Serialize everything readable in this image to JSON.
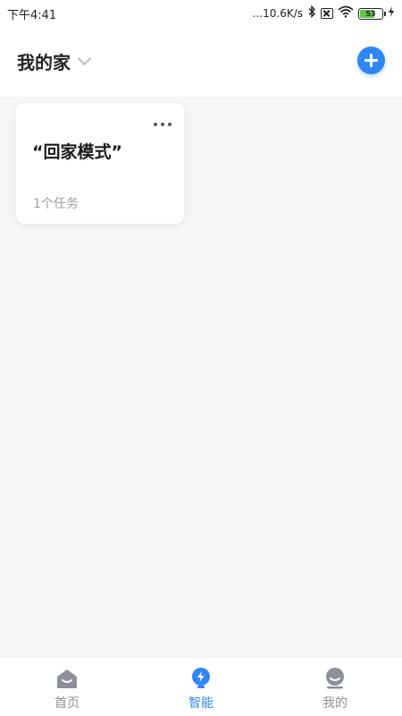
{
  "status_bar": {
    "time": "下午4:41",
    "network_speed": "...10.6K/s",
    "battery_level": "53",
    "icons": [
      "bluetooth-icon",
      "sim-off-icon",
      "wifi-icon",
      "battery-icon",
      "charging-icon"
    ]
  },
  "header": {
    "home_title": "我的家",
    "add_icon": "plus-icon",
    "accent_color": "#2f86f6"
  },
  "scenes": [
    {
      "title": "“回家模式”",
      "subtitle": "1个任务",
      "more_icon": "more-dots-icon"
    }
  ],
  "tabbar": {
    "tabs": [
      {
        "label": "首页",
        "icon": "home-icon",
        "active": false
      },
      {
        "label": "智能",
        "icon": "smart-bolt-icon",
        "active": true
      },
      {
        "label": "我的",
        "icon": "user-icon",
        "active": false
      }
    ],
    "active_color": "#2f86f6",
    "inactive_color": "#8d9098"
  }
}
